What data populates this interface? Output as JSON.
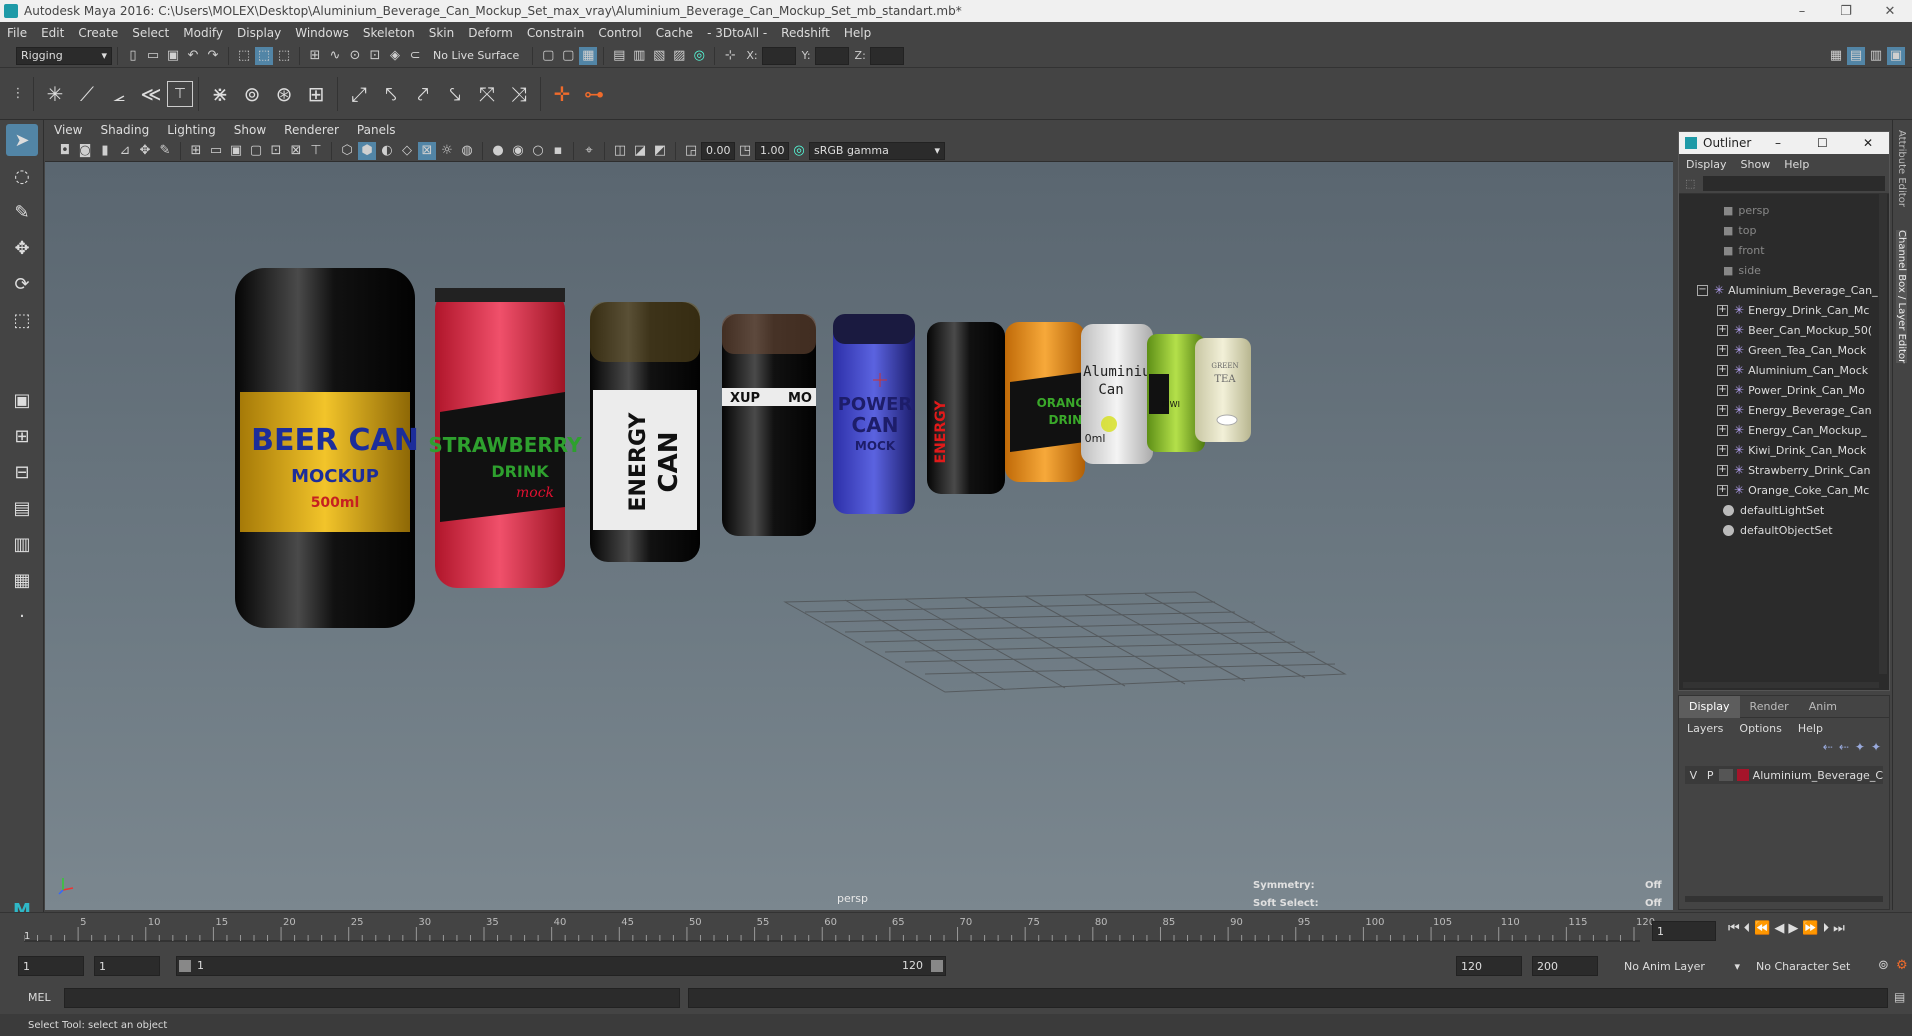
{
  "window": {
    "title": "Autodesk Maya 2016: C:\\Users\\MOLEX\\Desktop\\Aluminium_Beverage_Can_Mockup_Set_max_vray\\Aluminium_Beverage_Can_Mockup_Set_mb_standart.mb*"
  },
  "menubar": [
    "File",
    "Edit",
    "Create",
    "Select",
    "Modify",
    "Display",
    "Windows",
    "Skeleton",
    "Skin",
    "Deform",
    "Constrain",
    "Control",
    "Cache",
    "- 3DtoAll -",
    "Redshift",
    "Help"
  ],
  "statusline": {
    "menu_set": "Rigging",
    "live_surface": "No Live Surface",
    "x_label": "X:",
    "y_label": "Y:",
    "z_label": "Z:"
  },
  "viewport_menu": [
    "View",
    "Shading",
    "Lighting",
    "Show",
    "Renderer",
    "Panels"
  ],
  "viewport_toolbar": {
    "exposure": "0.00",
    "gamma": "1.00",
    "color_space": "sRGB gamma"
  },
  "viewport": {
    "camera": "persp",
    "symmetry_label": "Symmetry:",
    "symmetry_value": "Off",
    "soft_select_label": "Soft Select:",
    "soft_select_value": "Off"
  },
  "cans": [
    {
      "label": "BEER CAN",
      "sub": "MOCKUP",
      "extra": "500ml"
    },
    {
      "label": "STRAWBERRY",
      "sub": "DRINK",
      "extra": "mock"
    },
    {
      "label": "ENERGY",
      "sub": "CAN",
      "extra": ""
    },
    {
      "label": "XUP",
      "sub": "MO",
      "extra": ""
    },
    {
      "label": "POWER",
      "sub": "CAN",
      "extra": "MOCK"
    },
    {
      "label": "ENERGY",
      "sub": "",
      "extra": ""
    },
    {
      "label": "ORANGE",
      "sub": "DRINK",
      "extra": ""
    },
    {
      "label": "Aluminium",
      "sub": "Can",
      "extra": "0ml"
    },
    {
      "label": "KIWI",
      "sub": "",
      "extra": ""
    },
    {
      "label": "GREEN",
      "sub": "TEA",
      "extra": ""
    }
  ],
  "outliner": {
    "title": "Outliner",
    "menu": [
      "Display",
      "Show",
      "Help"
    ],
    "cameras": [
      "persp",
      "top",
      "front",
      "side"
    ],
    "root": "Aluminium_Beverage_Can_",
    "children": [
      "Energy_Drink_Can_Mc",
      "Beer_Can_Mockup_50(",
      "Green_Tea_Can_Mock",
      "Aluminium_Can_Mock",
      "Power_Drink_Can_Mo",
      "Energy_Beverage_Can",
      "Energy_Can_Mockup_",
      "Kiwi_Drink_Can_Mock",
      "Strawberry_Drink_Can",
      "Orange_Coke_Can_Mc"
    ],
    "sets": [
      "defaultLightSet",
      "defaultObjectSet"
    ]
  },
  "layers": {
    "tabs": [
      "Display",
      "Render",
      "Anim"
    ],
    "menu": [
      "Layers",
      "Options",
      "Help"
    ],
    "row": {
      "v": "V",
      "p": "P",
      "name": "Aluminium_Beverage_C",
      "color": "#a5142a"
    }
  },
  "side_tabs": {
    "attr": "Attribute Editor",
    "channel": "Channel Box / Layer Editor"
  },
  "timeline": {
    "ticks": [
      "5",
      "10",
      "15",
      "20",
      "25",
      "30",
      "35",
      "40",
      "45",
      "50",
      "55",
      "60",
      "65",
      "70",
      "75",
      "80",
      "85",
      "90",
      "95",
      "100",
      "105",
      "110",
      "115",
      "120"
    ],
    "start": "1",
    "current_frame": "1"
  },
  "range": {
    "start": "1",
    "inner_start": "1",
    "slider_start": "1",
    "slider_end": "120",
    "end": "120",
    "anim_end": "200",
    "anim_layer": "No Anim Layer",
    "char_set": "No Character Set"
  },
  "command": {
    "lang": "MEL"
  },
  "help": {
    "text": "Select Tool: select an object"
  },
  "colors": {
    "accent": "#5285a6",
    "ui_bg": "#444444"
  }
}
